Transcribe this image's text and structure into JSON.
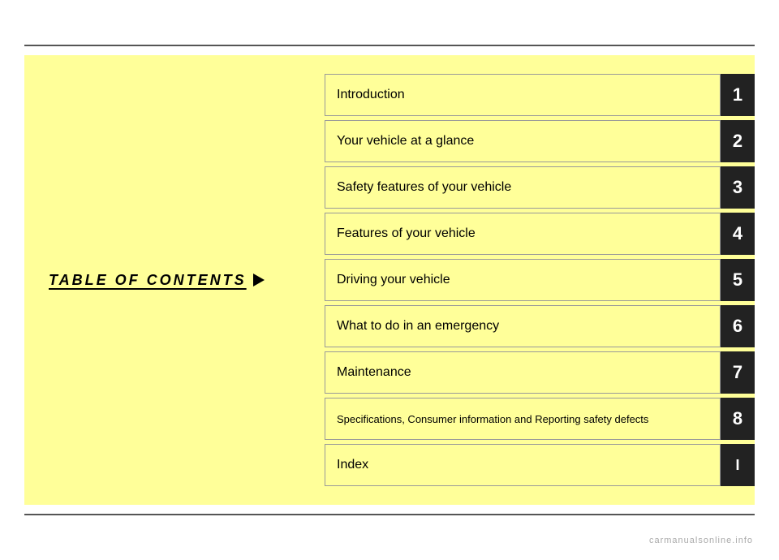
{
  "top_line": true,
  "bottom_line": true,
  "left_panel": {
    "title": "TABLE OF CONTENTS"
  },
  "toc": {
    "items": [
      {
        "label": "Introduction",
        "number": "1",
        "roman": false,
        "small": false
      },
      {
        "label": "Your vehicle at a glance",
        "number": "2",
        "roman": false,
        "small": false
      },
      {
        "label": "Safety features of your vehicle",
        "number": "3",
        "roman": false,
        "small": false
      },
      {
        "label": "Features of your vehicle",
        "number": "4",
        "roman": false,
        "small": false
      },
      {
        "label": "Driving your vehicle",
        "number": "5",
        "roman": false,
        "small": false
      },
      {
        "label": "What to do in an emergency",
        "number": "6",
        "roman": false,
        "small": false
      },
      {
        "label": "Maintenance",
        "number": "7",
        "roman": false,
        "small": false
      },
      {
        "label": "Specifications, Consumer information and Reporting safety defects",
        "number": "8",
        "roman": false,
        "small": true
      },
      {
        "label": "Index",
        "number": "I",
        "roman": true,
        "small": false
      }
    ]
  },
  "watermark": "carmanualsonline.info"
}
